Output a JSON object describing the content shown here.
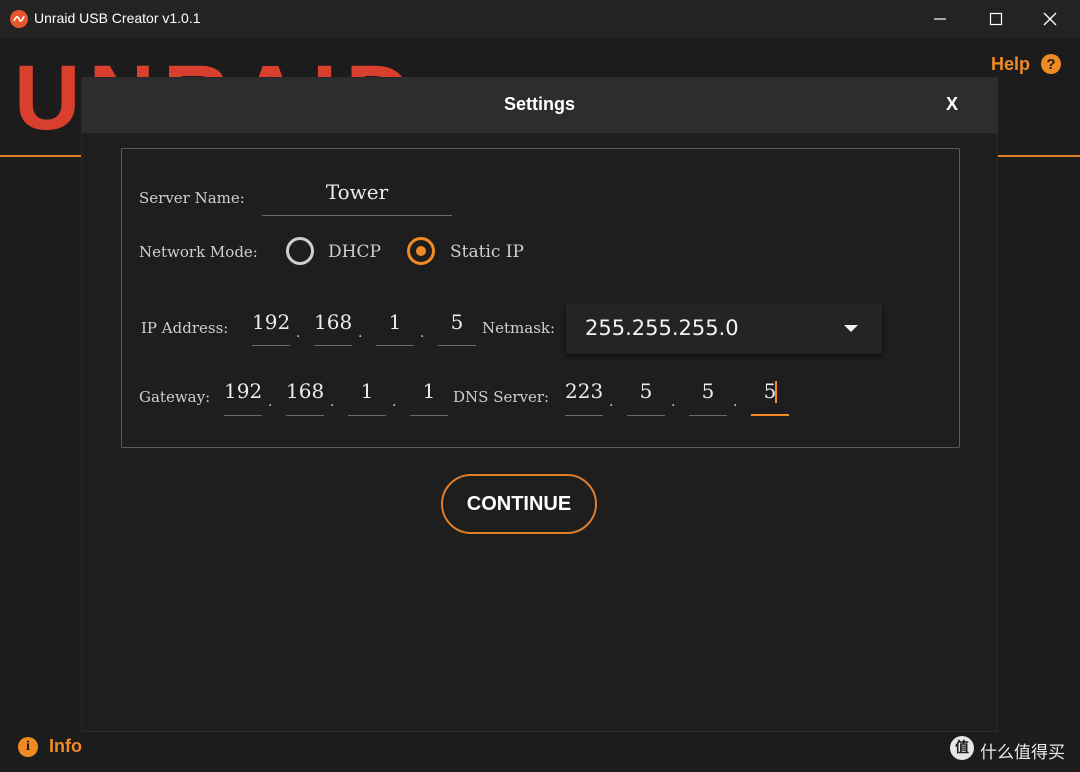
{
  "window": {
    "title": "Unraid USB Creator v1.0.1"
  },
  "app": {
    "logo_text": "UNRAID",
    "help_label": "Help",
    "help_icon_glyph": "?",
    "info_label": "Info",
    "info_icon_glyph": "i",
    "accent_color": "#f08a24"
  },
  "dialog": {
    "title": "Settings",
    "close_label": "X",
    "server_name": {
      "label": "Server Name:",
      "value": "Tower"
    },
    "network_mode": {
      "label": "Network Mode:",
      "options": [
        {
          "label": "DHCP",
          "selected": false
        },
        {
          "label": "Static IP",
          "selected": true
        }
      ]
    },
    "ip_address": {
      "label": "IP Address:",
      "octets": [
        "192",
        "168",
        "1",
        "5"
      ]
    },
    "netmask": {
      "label": "Netmask:",
      "value": "255.255.255.0"
    },
    "gateway": {
      "label": "Gateway:",
      "octets": [
        "192",
        "168",
        "1",
        "1"
      ]
    },
    "dns_server": {
      "label": "DNS Server:",
      "octets": [
        "223",
        "5",
        "5",
        "5"
      ]
    },
    "octet_separator": ".",
    "continue_label": "CONTINUE"
  },
  "watermark": {
    "glyph": "值",
    "text": "什么值得买"
  }
}
